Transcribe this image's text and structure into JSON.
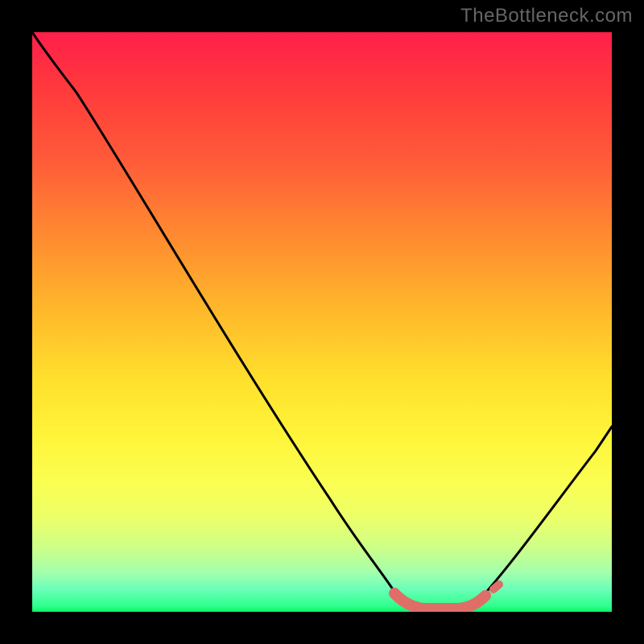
{
  "watermark": {
    "text": "TheBottleneck.com"
  },
  "colors": {
    "frame": "#000000",
    "curve": "#000000",
    "accent": "#de6e67",
    "gradient_top": "#ff1f4b",
    "gradient_bottom": "#08f566"
  },
  "chart_data": {
    "type": "line",
    "title": "",
    "xlabel": "",
    "ylabel": "",
    "xlim": [
      0,
      100
    ],
    "ylim": [
      0,
      100
    ],
    "grid": false,
    "legend_position": "none",
    "annotations": [],
    "series": [
      {
        "name": "bottleneck-curve",
        "x": [
          0,
          5,
          10,
          15,
          20,
          25,
          30,
          35,
          40,
          45,
          50,
          55,
          58,
          62,
          66,
          70,
          74,
          78,
          82,
          86,
          90,
          95,
          100
        ],
        "y": [
          100,
          96,
          90,
          83,
          76,
          68,
          60,
          52,
          44,
          36,
          28,
          20,
          12,
          5,
          1,
          0,
          0,
          1,
          4,
          9,
          15,
          24,
          34
        ]
      },
      {
        "name": "accent-segment",
        "x": [
          62,
          66,
          70,
          74,
          78
        ],
        "y": [
          5,
          1,
          0,
          1,
          4
        ]
      }
    ]
  }
}
